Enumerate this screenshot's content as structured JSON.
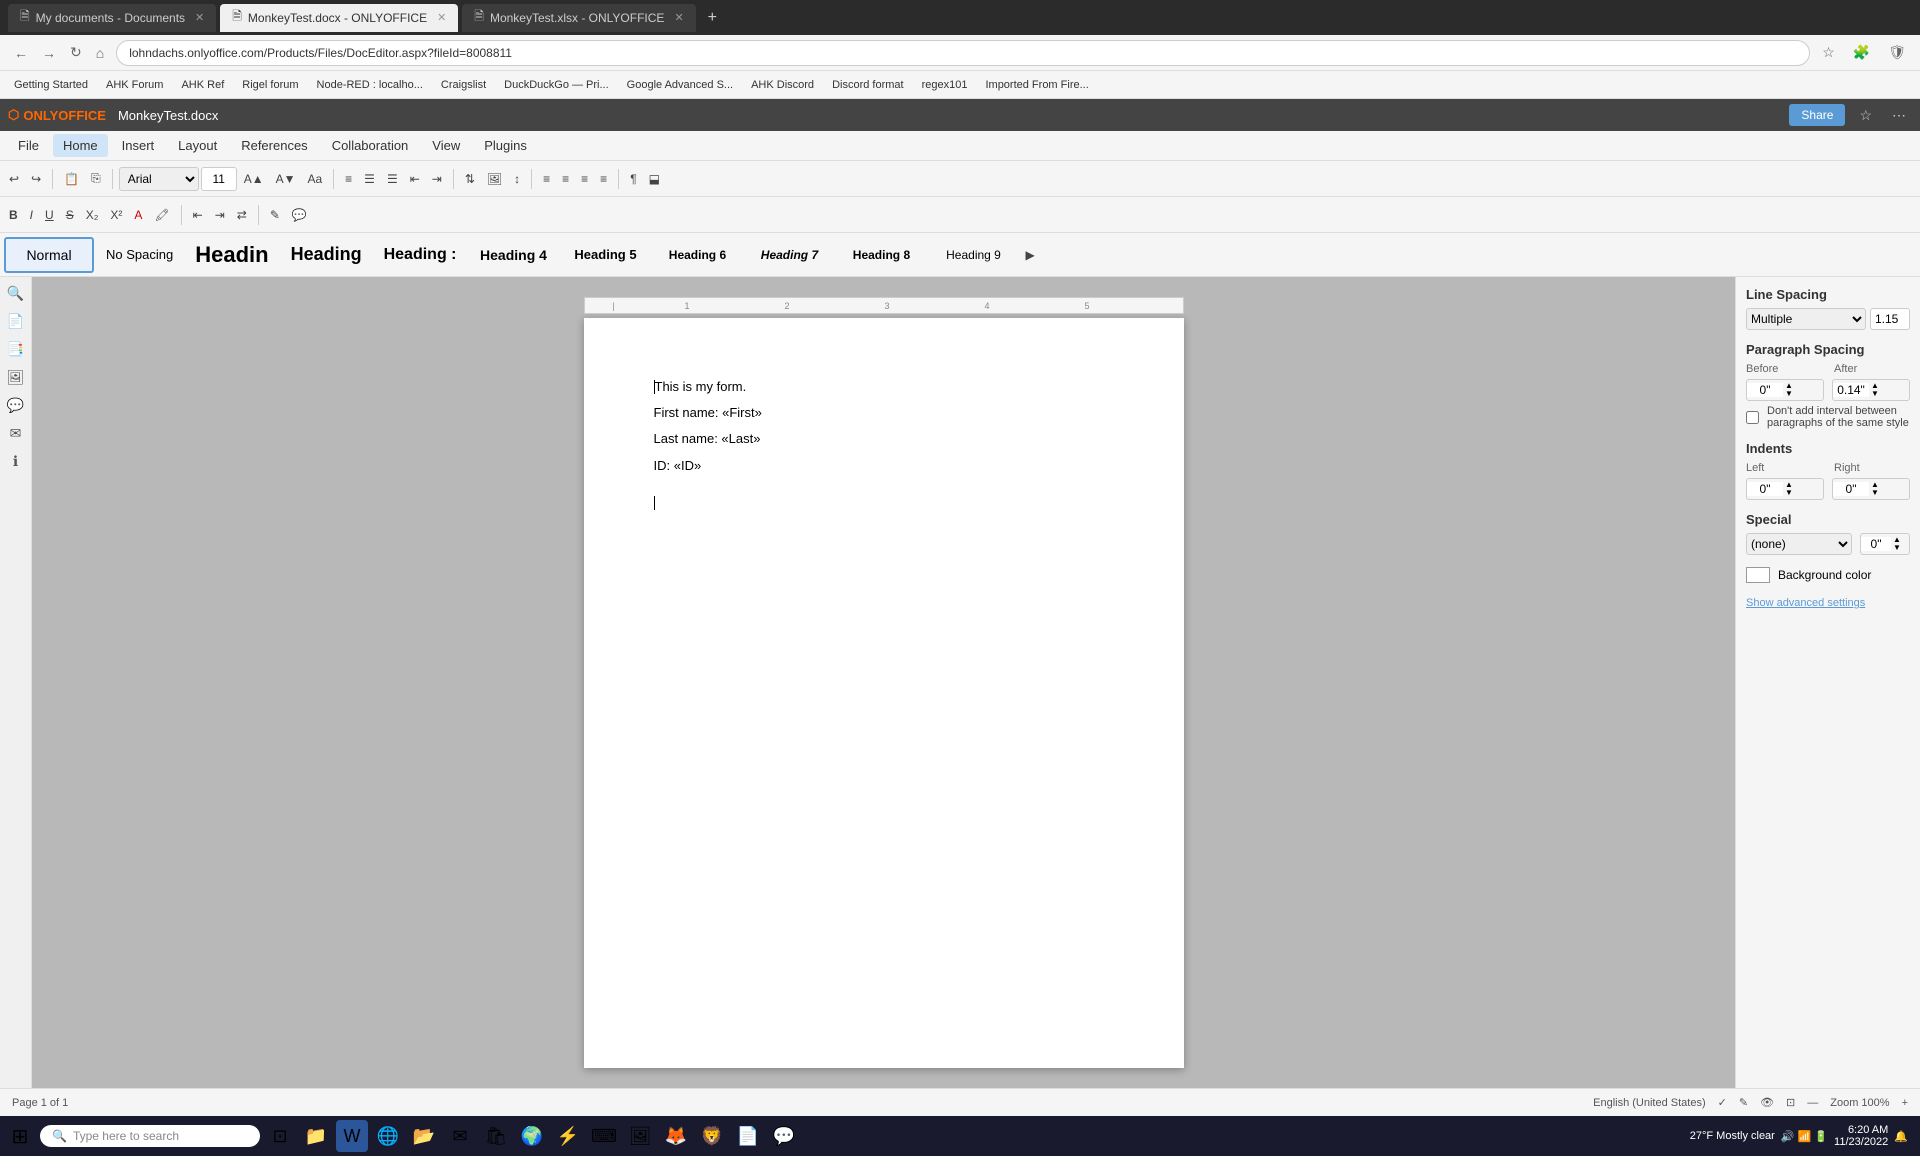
{
  "browser": {
    "tabs": [
      {
        "label": "My documents - Documents",
        "active": false,
        "icon": "🗎"
      },
      {
        "label": "MonkeyTest.docx - ONLYOFFICE",
        "active": true,
        "icon": "🗎"
      },
      {
        "label": "MonkeyTest.xlsx - ONLYOFFICE",
        "active": false,
        "icon": "🗎"
      }
    ],
    "address": "lohndachs.onlyoffice.com/Products/Files/DocEditor.aspx?fileId=8008811",
    "bookmarks": [
      "Getting Started",
      "AHK Forum",
      "AHK Ref",
      "Rigel forum",
      "Node-RED : localho...",
      "Craigslist",
      "DuckDuckGo — Pri...",
      "Google Advanced S...",
      "AHK Discord",
      "Discord format",
      "regex101",
      "Imported From Fire..."
    ]
  },
  "app": {
    "logo": "ONLYOFFICE",
    "doc_title": "MonkeyTest.docx",
    "share_label": "Share"
  },
  "menu": {
    "items": [
      "File",
      "Home",
      "Insert",
      "Layout",
      "References",
      "Collaboration",
      "View",
      "Plugins"
    ]
  },
  "styles_bar": {
    "normal_label": "Normal",
    "nospace_label": "No Spacing",
    "h1_label": "Headin",
    "h2_label": "Heading",
    "h3_label": "Heading :",
    "h4_label": "Heading 4",
    "h5_label": "Heading 5",
    "h6_label": "Heading 6",
    "h7_label": "Heading 7",
    "h8_label": "Heading 8",
    "h9_label": "Heading 9"
  },
  "toolbar": {
    "font_family": "Arial",
    "font_size": "11"
  },
  "document": {
    "lines": [
      "This is my form.",
      "First name: «First»",
      "Last name: «Last»",
      "ID: «ID»"
    ]
  },
  "right_panel": {
    "line_spacing_label": "Line Spacing",
    "line_spacing_type": "Multiple",
    "line_spacing_value": "1.15",
    "paragraph_spacing_label": "Paragraph Spacing",
    "before_label": "Before",
    "after_label": "After",
    "before_value": "0\"",
    "after_value": "0.14\"",
    "dont_add_interval": "Don't add interval between paragraphs of the same style",
    "indents_label": "Indents",
    "left_label": "Left",
    "right_label": "Right",
    "left_value": "0\"",
    "right_value": "0\"",
    "special_label": "Special",
    "special_value": "(none)",
    "special_right": "0\"",
    "background_color_label": "Background color",
    "advanced_settings": "Show advanced settings"
  },
  "status_bar": {
    "page_info": "Page 1 of 1",
    "language": "English (United States)",
    "zoom": "Zoom 100%"
  },
  "taskbar": {
    "search_placeholder": "Type here to search",
    "time": "6:20 AM",
    "date": "11/23/2022",
    "weather": "27°F  Mostly clear"
  }
}
